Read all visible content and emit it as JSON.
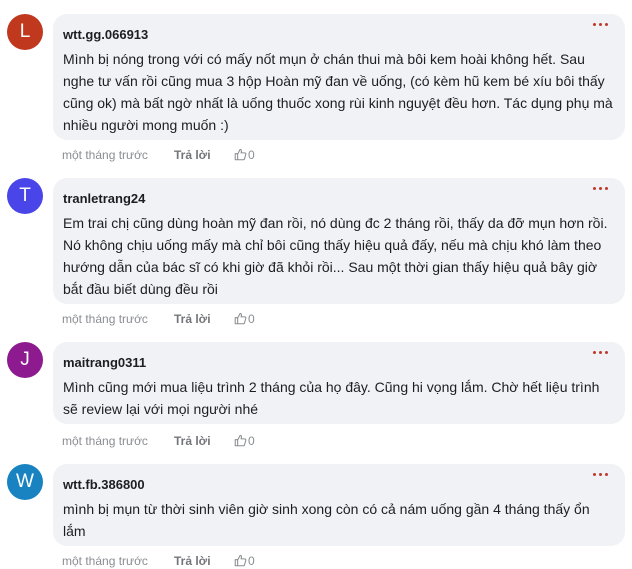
{
  "comments": [
    {
      "avatar_letter": "L",
      "avatar_color": "#c0391e",
      "author": "wtt.gg.066913",
      "text": "Mình bị nóng trong với có mấy nốt mụn ở chán thui mà bôi kem hoài không hết. Sau nghe tư vấn rồi cũng mua 3 hộp Hoàn mỹ đan về uống, (có kèm hũ kem bé xíu bôi thấy cũng ok) mà bất ngờ nhất là uống thuốc xong rùi kinh nguyệt đều hơn. Tác dụng phụ mà nhiều người mong muốn :)",
      "time": "một tháng trước",
      "reply_label": "Trả lời",
      "like_icon": "thumbs-up-icon",
      "likes": "0"
    },
    {
      "avatar_letter": "T",
      "avatar_color": "#4a45e8",
      "author": "tranletrang24",
      "text": "Em trai chị cũng dùng hoàn mỹ đan rồi, nó dùng đc 2 tháng rồi, thấy da đỡ mụn hơn rồi. Nó không chịu uống mấy mà chỉ bôi cũng thấy hiệu quả đấy, nếu mà chịu khó làm theo hướng dẫn của bác sĩ có khi giờ đã khỏi rồi... Sau một thời gian thấy hiệu quả bây giờ bắt đầu biết dùng đều rồi",
      "time": "một tháng trước",
      "reply_label": "Trả lời",
      "like_icon": "thumbs-up-icon",
      "likes": "0"
    },
    {
      "avatar_letter": "J",
      "avatar_color": "#8d1a8f",
      "author": "maitrang0311",
      "text": "Mình cũng mới mua liệu trình 2 tháng của họ đây. Cũng hi vọng lắm. Chờ hết liệu trình sẽ review lại với mọi người nhé",
      "time": "một tháng trước",
      "reply_label": "Trả lời",
      "like_icon": "thumbs-up-icon",
      "likes": "0"
    },
    {
      "avatar_letter": "W",
      "avatar_color": "#1883c0",
      "author": "wtt.fb.386800",
      "text": "mình bị mụn từ thời sinh viên giờ sinh xong còn có cả nám uống gần 4 tháng thấy ổn lắm",
      "time": "một tháng trước",
      "reply_label": "Trả lời",
      "like_icon": "thumbs-up-icon",
      "likes": "0"
    }
  ],
  "more_icon": "more-options-icon",
  "accent_color": "#c0392b"
}
